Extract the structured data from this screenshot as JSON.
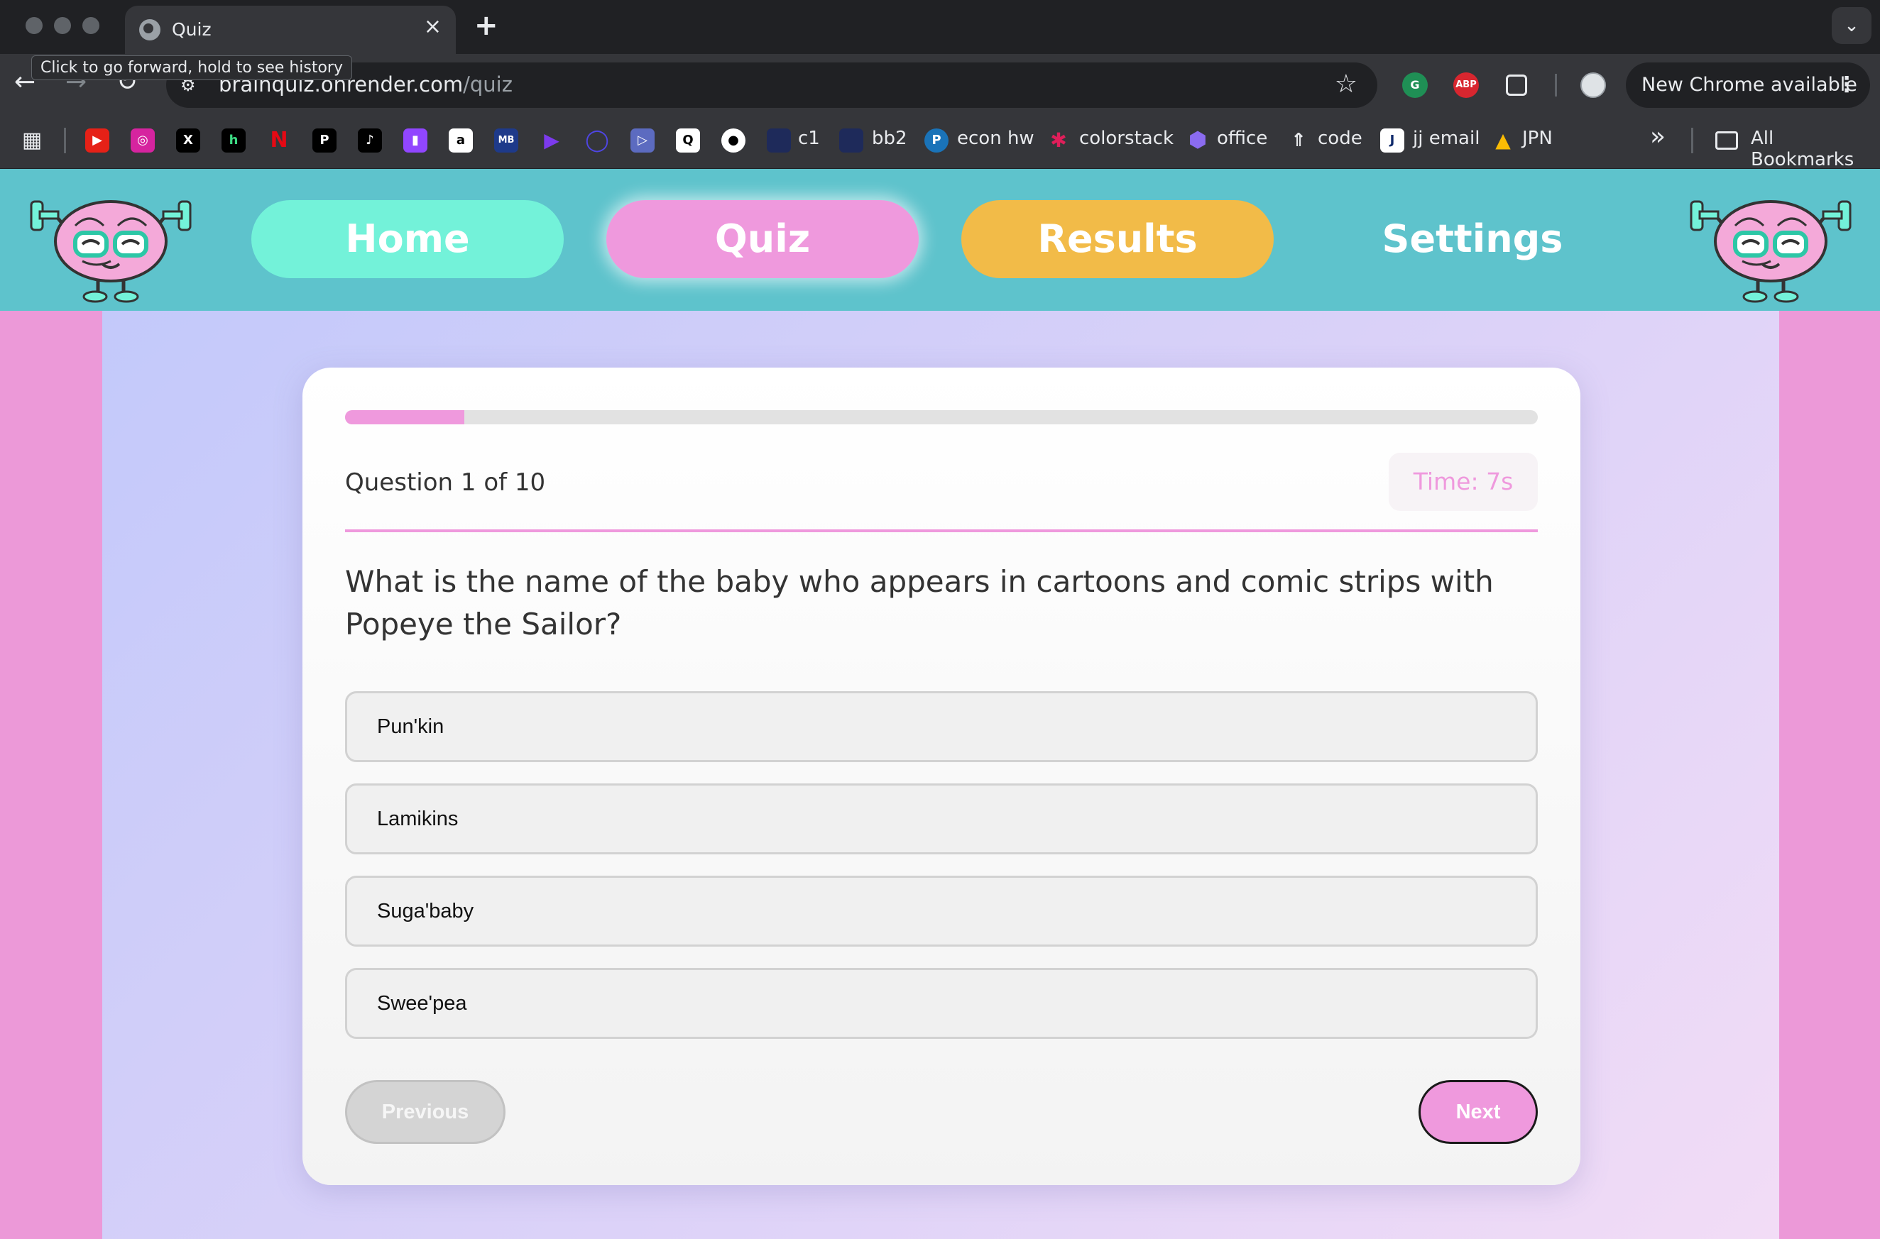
{
  "browser": {
    "tab_title": "Quiz",
    "tab_close": "×",
    "new_tab": "+",
    "tooltip": "Click to go forward, hold to see history",
    "url_host": "brainquiz.onrender.com",
    "url_path": "/quiz",
    "update_label": "New Chrome available",
    "ext_abp": "ABP",
    "bookmarks": [
      "c1",
      "bb2",
      "econ hw",
      "colorstack",
      "office",
      "code",
      "jj email",
      "JPN"
    ],
    "all_bookmarks": "All Bookmarks",
    "more_bookmarks": "»"
  },
  "nav": {
    "home": "Home",
    "quiz": "Quiz",
    "results": "Results",
    "settings": "Settings",
    "active": "Quiz"
  },
  "quiz": {
    "progress_fraction": 0.1,
    "question_counter": "Question 1 of 10",
    "timer": "Time: 7s",
    "question_text": "What is the name of the baby who appears in cartoons and comic strips with Popeye the Sailor?",
    "options": [
      "Pun'kin",
      "Lamikins",
      "Suga'baby",
      "Swee'pea"
    ],
    "previous_label": "Previous",
    "next_label": "Next"
  },
  "colors": {
    "header_bg": "#5ec3cc",
    "home_pill": "#73f2d9",
    "quiz_pill": "#ef99dd",
    "results_pill": "#f2bb48",
    "accent_pink": "#ef99dd",
    "side_pink": "#ec99d8"
  }
}
